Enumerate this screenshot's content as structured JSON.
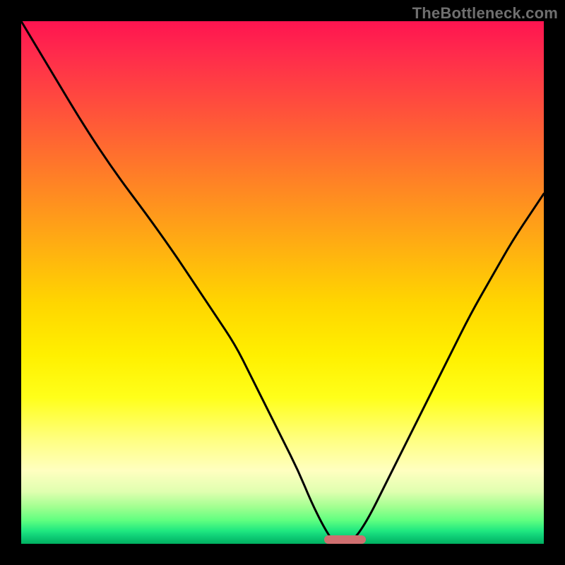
{
  "watermark": "TheBottleneck.com",
  "colors": {
    "frame": "#000000",
    "curve": "#000000",
    "marker": "#cf6f70",
    "gradient_top": "#ff1450",
    "gradient_mid": "#ffd600",
    "gradient_bottom": "#00b060"
  },
  "chart_data": {
    "type": "line",
    "title": "",
    "xlabel": "",
    "ylabel": "",
    "xlim": [
      0,
      100
    ],
    "ylim": [
      0,
      100
    ],
    "grid": false,
    "legend": false,
    "series": [
      {
        "name": "bottleneck-curve",
        "x": [
          0,
          6,
          12,
          18,
          24,
          29,
          33,
          37,
          41,
          44,
          47,
          50,
          53,
          55.5,
          58,
          60,
          63,
          66,
          70,
          74,
          78,
          82,
          86,
          90,
          94,
          98,
          100
        ],
        "y": [
          100,
          90,
          80,
          71,
          63,
          56,
          50,
          44,
          38,
          32,
          26,
          20,
          14,
          8,
          3,
          0,
          0,
          4,
          12,
          20,
          28,
          36,
          44,
          51,
          58,
          64,
          67
        ]
      }
    ],
    "optimal_range_x": [
      58,
      66
    ],
    "annotations": []
  }
}
